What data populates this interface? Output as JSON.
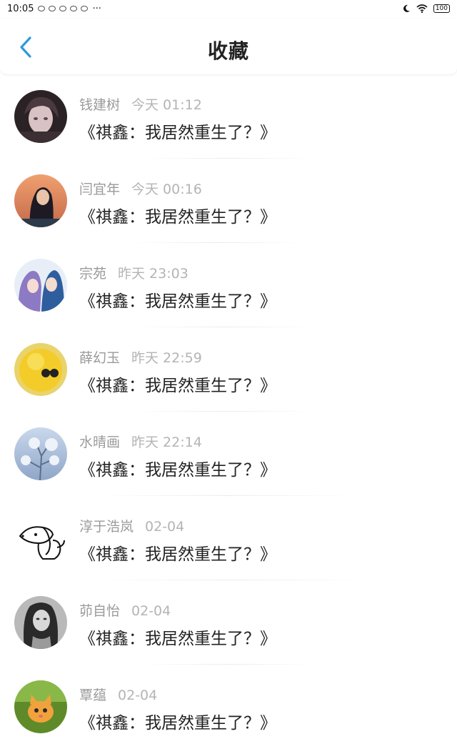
{
  "status_bar": {
    "time": "10:05",
    "extra": "···",
    "battery": "100"
  },
  "header": {
    "title": "收藏"
  },
  "favorites": [
    {
      "name": "钱建树",
      "time": "今天 01:12",
      "content": "《祺鑫：我居然重生了？》",
      "avatar": "anime-girl-dark"
    },
    {
      "name": "闫宜年",
      "time": "今天 00:16",
      "content": "《祺鑫：我居然重生了？》",
      "avatar": "girl-sunset"
    },
    {
      "name": "宗苑",
      "time": "昨天 23:03",
      "content": "《祺鑫：我居然重生了？》",
      "avatar": "anime-couple"
    },
    {
      "name": "薛幻玉",
      "time": "昨天 22:59",
      "content": "《祺鑫：我居然重生了？》",
      "avatar": "yellow-chick"
    },
    {
      "name": "水晴画",
      "time": "昨天 22:14",
      "content": "《祺鑫：我居然重生了？》",
      "avatar": "frosty-tree"
    },
    {
      "name": "淳于浩岚",
      "time": "02-04",
      "content": "《祺鑫：我居然重生了？》",
      "avatar": "dog-sketch"
    },
    {
      "name": "茆自怡",
      "time": "02-04",
      "content": "《祺鑫：我居然重生了？》",
      "avatar": "woman-bw"
    },
    {
      "name": "覃蕴",
      "time": "02-04",
      "content": "《祺鑫：我居然重生了？》",
      "avatar": "orange-kitten"
    }
  ],
  "colors": {
    "accent": "#2f9bd8",
    "name": "#9a9a9a",
    "time": "#b4b4b4",
    "text": "#222222"
  }
}
